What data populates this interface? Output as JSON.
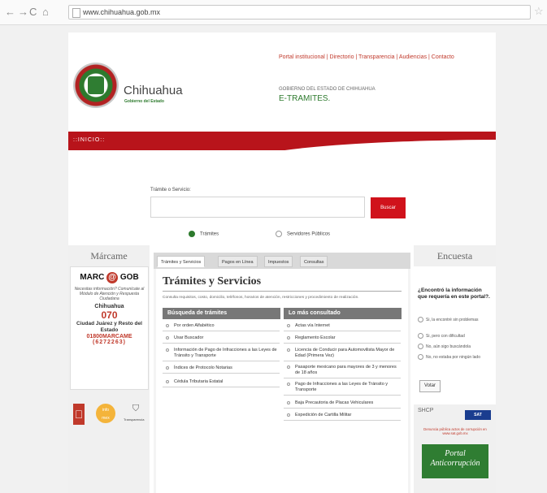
{
  "browser": {
    "url": "www.chihuahua.gob.mx"
  },
  "header": {
    "brand_name": "Chihuahua",
    "brand_sub": "Gobierno del Estado",
    "top_links": "Portal institucional  |  Directorio  |  Transparencia  |  Audiencias  |  Contacto",
    "gobierno": "GOBIERNO DEL ESTADO DE CHIHUAHUA",
    "etramites": "E-TRAMITES."
  },
  "nav": {
    "inicio": "::INICIO::"
  },
  "search": {
    "label": "Trámite o Servicio:",
    "button": "Buscar",
    "options": [
      "Trámites",
      "Servidores Públicos"
    ]
  },
  "left": {
    "heading": "Márcame",
    "logo_left": "MARC",
    "logo_at": "@",
    "logo_right": "GOB",
    "slogan": "Necesitas información? Comunícate al Módulo de Atención y Respuesta Ciudadana",
    "city": "Chihuahua",
    "phone": "070",
    "cj": "Ciudad Juárez y Resto del Estado",
    "tollfree": "01800MARCAME",
    "tollfree_num": "(6272263)",
    "transparencia": "Transparencia"
  },
  "center": {
    "tabs": [
      "Trámites y Servicios",
      "Pagos en Línea",
      "Impuestos",
      "Consultas"
    ],
    "title": "Trámites y Servicios",
    "desc": "Consulta requisitos, costo, domicilio, teléfonos, horarios de atención, restricciones y procedimiento de realización.",
    "col1_header": "Búsqueda de trámites",
    "col2_header": "Lo más consultado",
    "col1_items": [
      "Por orden Alfabético",
      "Usar Buscador",
      "Información de Pago de Infracciones a las Leyes de Tránsito y Transporte",
      "Índices de Protocolo Notarias",
      "Cédula Tributaria Estatal"
    ],
    "col2_items": [
      "Actas vía Internet",
      "Reglamento Escolar",
      "Licencia de Conducir para Automovilista Mayor de Edad (Primera Vez)",
      "Pasaporte mexicano para mayores de 3 y menores de 18 años",
      "Pago de Infracciones a las Leyes de Tránsito y Transporte",
      "Baja Precautoria de Placas Vehiculares",
      "Expedición de Cartilla Militar"
    ]
  },
  "right": {
    "heading": "Encuesta",
    "question": "¿Encontró la información que requería en este portal?.",
    "options": [
      "Si, la encontré sin problemas",
      "Si, pero con dificultad",
      "No, aún sigo buscándola",
      "No, no estaba por ningún lado"
    ],
    "vote": "Votar",
    "shcp": "SHCP",
    "sat": "SAT",
    "denuncia": "Denuncia pública actos de corrupción en www.sat.gob.mx",
    "anti": "Portal Anticorrupción"
  }
}
